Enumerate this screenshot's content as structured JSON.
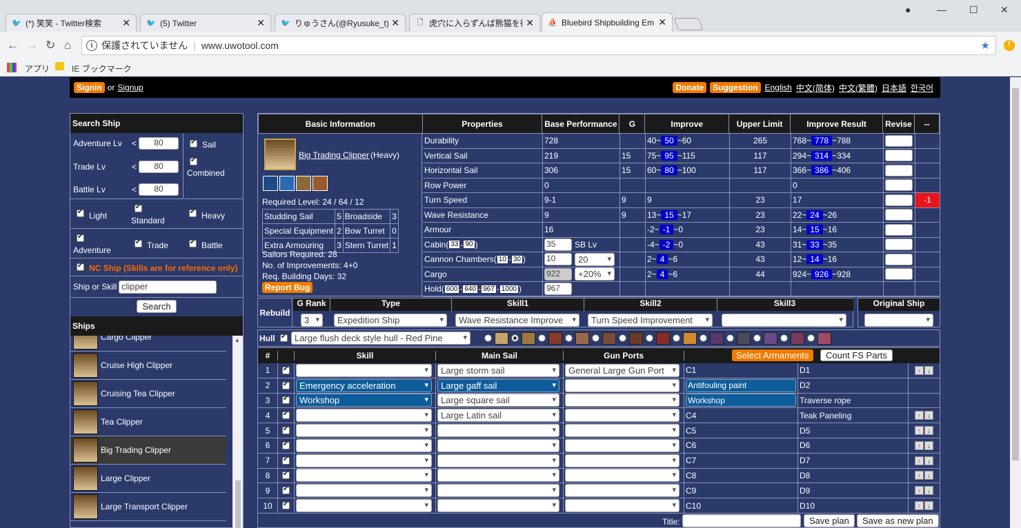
{
  "browser": {
    "tabs": [
      {
        "icon": "twitter-icon",
        "title": "(*) 笑笑 - Twitter検索"
      },
      {
        "icon": "twitter-icon",
        "title": "(5) Twitter"
      },
      {
        "icon": "twitter-icon",
        "title": "りゅうさん(@Ryusuke_t)さん"
      },
      {
        "icon": "page-icon",
        "title": "虎穴に入らずんば熊猫を得ず"
      },
      {
        "icon": "ship-icon",
        "title": "Bluebird Shipbuilding Em"
      }
    ],
    "security": "保護されていません",
    "url": "www.uwotool.com",
    "bookmarks": {
      "apps": "アプリ",
      "ie": "IE ブックマーク"
    }
  },
  "topbar": {
    "signin": "Signin",
    "or": "or",
    "signup": "Signup",
    "donate": "Donate",
    "suggestion": "Suggestion",
    "langs": [
      "English",
      "中文(简体)",
      "中文(繁體)",
      "日本語",
      "한국어"
    ]
  },
  "search": {
    "title": "Search Ship",
    "adv_label": "Adventure Lv",
    "adv_val": "80",
    "trade_label": "Trade Lv",
    "trade_val": "80",
    "battle_label": "Battle Lv",
    "battle_val": "80",
    "lt": "<",
    "sail": "Sail",
    "combined": "Combined",
    "light": "Light",
    "standard": "Standard",
    "heavy": "Heavy",
    "adventure": "Adventure",
    "trade": "Trade",
    "battle": "Battle",
    "nc": "NC Ship (Skills are for reference only)",
    "ship_or_skill": "Ship or Skill",
    "query": "clipper",
    "search_btn": "Search",
    "ships_title": "Ships",
    "ships": [
      "Cargo Clipper",
      "Cruise High Clipper",
      "Cruising Tea Clipper",
      "Tea Clipper",
      "Big Trading Clipper",
      "Large Clipper",
      "Large Transport Clipper"
    ]
  },
  "basic": {
    "header": "Basic Information",
    "ship_name": "Big Trading Clipper",
    "ship_type": "(Heavy)",
    "required_level": "Required Level: 24 / 64 / 12",
    "cannons": [
      [
        "Studding Sail",
        "5",
        "Broadside",
        "3"
      ],
      [
        "Special Equipment",
        "2",
        "Bow Turret",
        "0"
      ],
      [
        "Extra Armouring",
        "3",
        "Stern Turret",
        "1"
      ]
    ],
    "sailors": "Sailors Required: 28",
    "improvements": "No. of Improvements: 4+0",
    "days": "Req. Building Days: 32",
    "report": "Report Bug"
  },
  "props": {
    "headers": [
      "Properties",
      "Base Performance",
      "G",
      "Improve",
      "Upper Limit",
      "Improve Result",
      "Revise",
      "--"
    ],
    "rows": [
      {
        "name": "Durability",
        "base": "728",
        "g": "",
        "imp_a": "40~",
        "imp_b": "50",
        "imp_c": "~60",
        "upper": "265",
        "res_a": "768~",
        "res_b": "778",
        "res_c": "~788",
        "rev": ""
      },
      {
        "name": "Vertical Sail",
        "base": "219",
        "g": "15",
        "imp_a": "75~",
        "imp_b": "95",
        "imp_c": "~115",
        "upper": "117",
        "res_a": "294~",
        "res_b": "314",
        "res_c": "~334",
        "rev": ""
      },
      {
        "name": "Horizontal Sail",
        "base": "306",
        "g": "15",
        "imp_a": "60~",
        "imp_b": "80",
        "imp_c": "~100",
        "upper": "117",
        "res_a": "366~",
        "res_b": "386",
        "res_c": "~406",
        "rev": ""
      },
      {
        "name": "Row Power",
        "base": "0",
        "g": "",
        "imp_a": "",
        "imp_b": "",
        "imp_c": "",
        "upper": "",
        "res_a": "0",
        "res_b": "",
        "res_c": "",
        "rev": ""
      },
      {
        "name": "Turn Speed",
        "base": "9-1",
        "g": "9",
        "imp_a": "9",
        "imp_b": "",
        "imp_c": "",
        "upper": "23",
        "res_a": "17",
        "res_b": "",
        "res_c": "",
        "rev": "-1"
      },
      {
        "name": "Wave Resistance",
        "base": "9",
        "g": "9",
        "imp_a": "13~",
        "imp_b": "15",
        "imp_c": "~17",
        "upper": "23",
        "res_a": "22~",
        "res_b": "24",
        "res_c": "~26",
        "rev": ""
      },
      {
        "name": "Armour",
        "base": "16",
        "g": "",
        "imp_a": "-2~",
        "imp_b": "-1",
        "imp_c": "~0",
        "upper": "23",
        "res_a": "14~",
        "res_b": "15",
        "res_c": "~16",
        "rev": ""
      },
      {
        "name": "Cabin",
        "base": "35",
        "g": "",
        "imp_a": "-4~",
        "imp_b": "-2",
        "imp_c": "~0",
        "upper": "43",
        "res_a": "31~",
        "res_b": "33",
        "res_c": "~35",
        "rev": ""
      },
      {
        "name": "Cannon Chambers",
        "base": "10",
        "g": "",
        "imp_a": "2~",
        "imp_b": "4",
        "imp_c": "~6",
        "upper": "43",
        "res_a": "12~",
        "res_b": "14",
        "res_c": "~16",
        "rev": ""
      },
      {
        "name": "Cargo",
        "base": "922",
        "g": "",
        "imp_a": "2~",
        "imp_b": "4",
        "imp_c": "~6",
        "upper": "44",
        "res_a": "924~",
        "res_b": "926",
        "res_c": "~928",
        "rev": ""
      },
      {
        "name": "Hold",
        "base": "967",
        "g": "",
        "imp_a": "",
        "imp_b": "",
        "imp_c": "",
        "upper": "",
        "res_a": "",
        "res_b": "",
        "res_c": "",
        "rev": ""
      }
    ],
    "cabin_range": [
      "33",
      "90"
    ],
    "cannon_range": [
      "10",
      "30"
    ],
    "hold_range": [
      "600",
      "640",
      "967",
      "1000"
    ],
    "sb_label": "SB Lv",
    "sb_val": "20",
    "sb_pct": "+20%"
  },
  "rebuild": {
    "label": "Rebuild",
    "headers": [
      "G Rank",
      "Type",
      "Skill1",
      "Skill2",
      "Skill3",
      "Original Ship"
    ],
    "grank": "3",
    "type": "Expedition Ship",
    "skill1": "Wave Resistance Improve",
    "skill2": "Turn Speed Improvement",
    "skill3": "",
    "orig": ""
  },
  "hull": {
    "label": "Hull",
    "value": "Large flush deck style hull - Red Pine"
  },
  "parts": {
    "headers": [
      "#",
      "",
      "Skill",
      "Main Sail",
      "Gun Ports"
    ],
    "select_arm": "Select Armaments",
    "count_fs": "Count FS Parts",
    "rows": [
      {
        "n": "1",
        "skill": "",
        "sail": "Large storm sail",
        "gun": "General Large Gun Port",
        "c": "C1",
        "d": "D1"
      },
      {
        "n": "2",
        "skill": "Emergency acceleration",
        "sail": "Large gaff sail",
        "gun": "",
        "c": "Antifouling paint",
        "d": "D2"
      },
      {
        "n": "3",
        "skill": "Workshop",
        "sail": "Large square sail",
        "gun": "",
        "c": "Workshop",
        "d": "Traverse rope"
      },
      {
        "n": "4",
        "skill": "",
        "sail": "Large Latin sail",
        "gun": "",
        "c": "C4",
        "d": "Teak Paneling"
      },
      {
        "n": "5",
        "skill": "",
        "sail": "",
        "gun": "",
        "c": "C5",
        "d": "D5"
      },
      {
        "n": "6",
        "skill": "",
        "sail": "",
        "gun": "",
        "c": "C6",
        "d": "D6"
      },
      {
        "n": "7",
        "skill": "",
        "sail": "",
        "gun": "",
        "c": "C7",
        "d": "D7"
      },
      {
        "n": "8",
        "skill": "",
        "sail": "",
        "gun": "",
        "c": "C8",
        "d": "D8"
      },
      {
        "n": "9",
        "skill": "",
        "sail": "",
        "gun": "",
        "c": "C9",
        "d": "D9"
      },
      {
        "n": "10",
        "skill": "",
        "sail": "",
        "gun": "",
        "c": "C10",
        "d": "D10"
      }
    ],
    "title_label": "Title:",
    "save": "Save plan",
    "save_new": "Save as new plan"
  }
}
